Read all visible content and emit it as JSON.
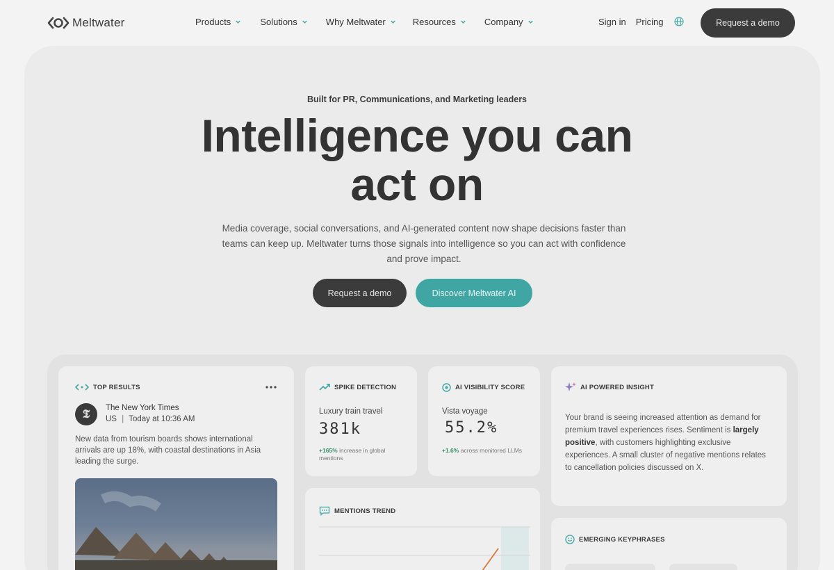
{
  "nav": {
    "logo_text": "Meltwater",
    "menu": [
      {
        "label": "Products"
      },
      {
        "label": "Solutions"
      },
      {
        "label": "Why Meltwater"
      },
      {
        "label": "Resources"
      },
      {
        "label": "Company"
      }
    ],
    "sign_in": "Sign in",
    "pricing": "Pricing",
    "globe_icon": "globe-icon",
    "cta": "Request a demo"
  },
  "hero": {
    "eyebrow": "Built for PR, Communications, and Marketing leaders",
    "headline_line1": "Intelligence you can",
    "headline_line2": "act on",
    "subtext": "Media coverage, social conversations, and AI-generated content now shape decisions faster than teams can keep up. Meltwater turns those signals into intelligence so you can act with confidence and prove impact.",
    "primary_cta": "Request a demo",
    "secondary_cta": "Discover Meltwater AI"
  },
  "dashboard": {
    "top_results": {
      "title": "TOP RESULTS",
      "source": "The New York Times",
      "region": "US",
      "time": "Today at 10:36 AM",
      "snippet": "New data from tourism boards shows international arrivals are up 18%, with coastal destinations in Asia leading the surge."
    },
    "spike": {
      "title": "SPIKE DETECTION",
      "topic": "Luxury train travel",
      "value": "381k",
      "delta": "+165%",
      "delta_text": "increase in global mentions"
    },
    "visibility": {
      "title": "AI VISIBILITY SCORE",
      "topic": "Vista voyage",
      "value": "55.2%",
      "delta": "+1.6%",
      "delta_text": "across monitored LLMs"
    },
    "insight": {
      "title": "AI POWERED INSIGHT",
      "text_before": "Your brand is seeing increased attention as demand for premium travel experiences rises. Sentiment is ",
      "text_bold": "largely positive",
      "text_after": ", with customers highlighting exclusive experiences. A small cluster of negative mentions relates to cancellation policies discussed on X."
    },
    "mentions": {
      "title": "MENTIONS TREND"
    },
    "keyphrases": {
      "title": "EMERGING KEYPHRASES"
    }
  },
  "colors": {
    "teal": "#3fa6a3",
    "dark_button": "#3b3b3b",
    "accent_orange": "#d9773a"
  }
}
